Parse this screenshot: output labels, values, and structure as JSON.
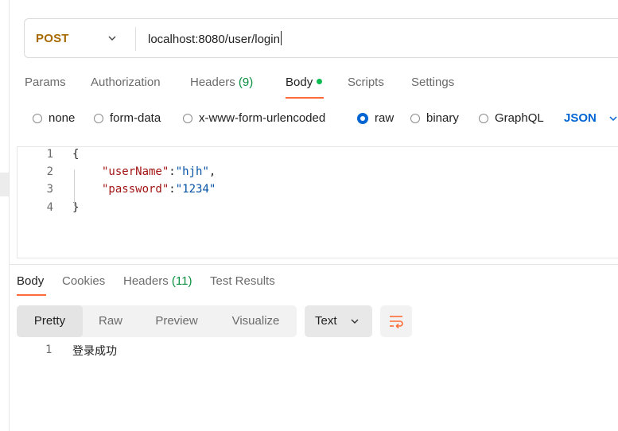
{
  "request": {
    "method": "POST",
    "url": "localhost:8080/user/login"
  },
  "request_tabs": [
    {
      "label": "Params"
    },
    {
      "label": "Authorization"
    },
    {
      "label": "Headers",
      "count": "(9)"
    },
    {
      "label": "Body"
    },
    {
      "label": "Scripts"
    },
    {
      "label": "Settings"
    }
  ],
  "body_types": [
    {
      "label": "none"
    },
    {
      "label": "form-data"
    },
    {
      "label": "x-www-form-urlencoded"
    },
    {
      "label": "raw",
      "selected": true
    },
    {
      "label": "binary"
    },
    {
      "label": "GraphQL"
    }
  ],
  "body_format": "JSON",
  "editor": {
    "lines": [
      {
        "n": "1",
        "open": "{"
      },
      {
        "n": "2",
        "key": "\"userName\"",
        "sep": ":",
        "value": "\"hjh\"",
        "tail": ","
      },
      {
        "n": "3",
        "key": "\"password\"",
        "sep": ":",
        "value": "\"1234\"",
        "tail": ""
      },
      {
        "n": "4",
        "close": "}"
      }
    ]
  },
  "response_tabs": [
    {
      "label": "Body"
    },
    {
      "label": "Cookies"
    },
    {
      "label": "Headers",
      "count": "(11)"
    },
    {
      "label": "Test Results"
    }
  ],
  "response_views": [
    "Pretty",
    "Raw",
    "Preview",
    "Visualize"
  ],
  "response_format": "Text",
  "response_body": [
    {
      "n": "1",
      "text": "登录成功"
    }
  ],
  "colors": {
    "method": "#a86a00",
    "accent": "#ff6c37",
    "selected": "#0265d2",
    "body_dot": "#0cbb52",
    "json_key": "#a31515",
    "json_value": "#0451a5"
  },
  "icons": [
    "chevron-down-icon",
    "radio-icon",
    "wrap-lines-icon"
  ]
}
